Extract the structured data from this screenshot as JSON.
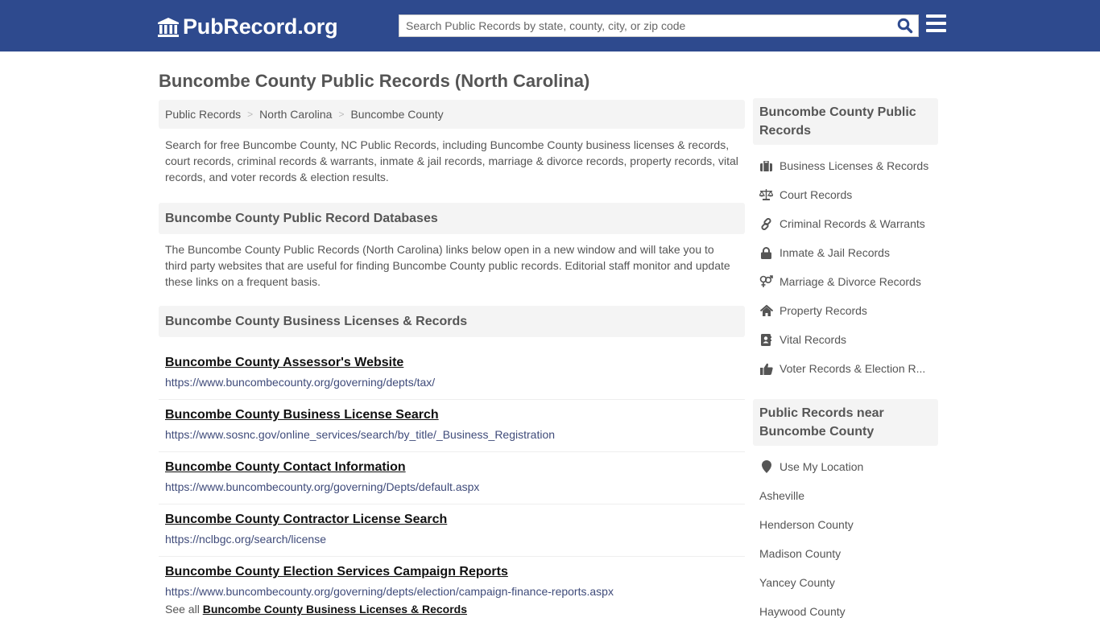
{
  "header": {
    "logo_text": "PubRecord.org",
    "search_placeholder": "Search Public Records by state, county, city, or zip code",
    "search_value": "",
    "colors": {
      "topbar": "#2e4a8e",
      "search_icon": "#2e4a8e"
    }
  },
  "page": {
    "title": "Buncombe County Public Records (North Carolina)"
  },
  "breadcrumb": [
    {
      "label": "Public Records"
    },
    {
      "label": "North Carolina"
    },
    {
      "label": "Buncombe County"
    }
  ],
  "breadcrumb_separator": ">",
  "intro": "Search for free Buncombe County, NC Public Records, including Buncombe County business licenses & records, court records, criminal records & warrants, inmate & jail records, marriage & divorce records, property records, vital records, and voter records & election results.",
  "databases": {
    "heading": "Buncombe County Public Record Databases",
    "description": "The Buncombe County Public Records (North Carolina) links below open in a new window and will take you to third party websites that are useful for finding Buncombe County public records. Editorial staff monitor and update these links on a frequent basis."
  },
  "business_section": {
    "heading": "Buncombe County Business Licenses & Records",
    "links": [
      {
        "title": "Buncombe County Assessor's Website",
        "url": "https://www.buncombecounty.org/governing/depts/tax/"
      },
      {
        "title": "Buncombe County Business License Search",
        "url": "https://www.sosnc.gov/online_services/search/by_title/_Business_Registration"
      },
      {
        "title": "Buncombe County Contact Information",
        "url": "https://www.buncombecounty.org/governing/Depts/default.aspx"
      },
      {
        "title": "Buncombe County Contractor License Search",
        "url": "https://nclbgc.org/search/license"
      },
      {
        "title": "Buncombe County Election Services Campaign Reports",
        "url": "https://www.buncombecounty.org/governing/depts/election/campaign-finance-reports.aspx"
      }
    ],
    "see_all_prefix": "See all",
    "see_all_link": "Buncombe County Business Licenses & Records"
  },
  "sidebar": {
    "records_heading": "Buncombe County Public Records",
    "records": [
      {
        "label": "Business Licenses & Records",
        "icon": "briefcase-icon"
      },
      {
        "label": "Court Records",
        "icon": "balance-scale-icon"
      },
      {
        "label": "Criminal Records & Warrants",
        "icon": "link-icon"
      },
      {
        "label": "Inmate & Jail Records",
        "icon": "lock-icon"
      },
      {
        "label": "Marriage & Divorce Records",
        "icon": "venus-mars-icon"
      },
      {
        "label": "Property Records",
        "icon": "home-icon"
      },
      {
        "label": "Vital Records",
        "icon": "address-book-icon"
      },
      {
        "label": "Voter Records & Election R...",
        "icon": "thumbs-up-icon"
      }
    ],
    "near_heading": "Public Records near Buncombe County",
    "use_location": "Use My Location",
    "nearby": [
      {
        "label": "Asheville"
      },
      {
        "label": "Henderson County"
      },
      {
        "label": "Madison County"
      },
      {
        "label": "Yancey County"
      },
      {
        "label": "Haywood County"
      }
    ]
  }
}
